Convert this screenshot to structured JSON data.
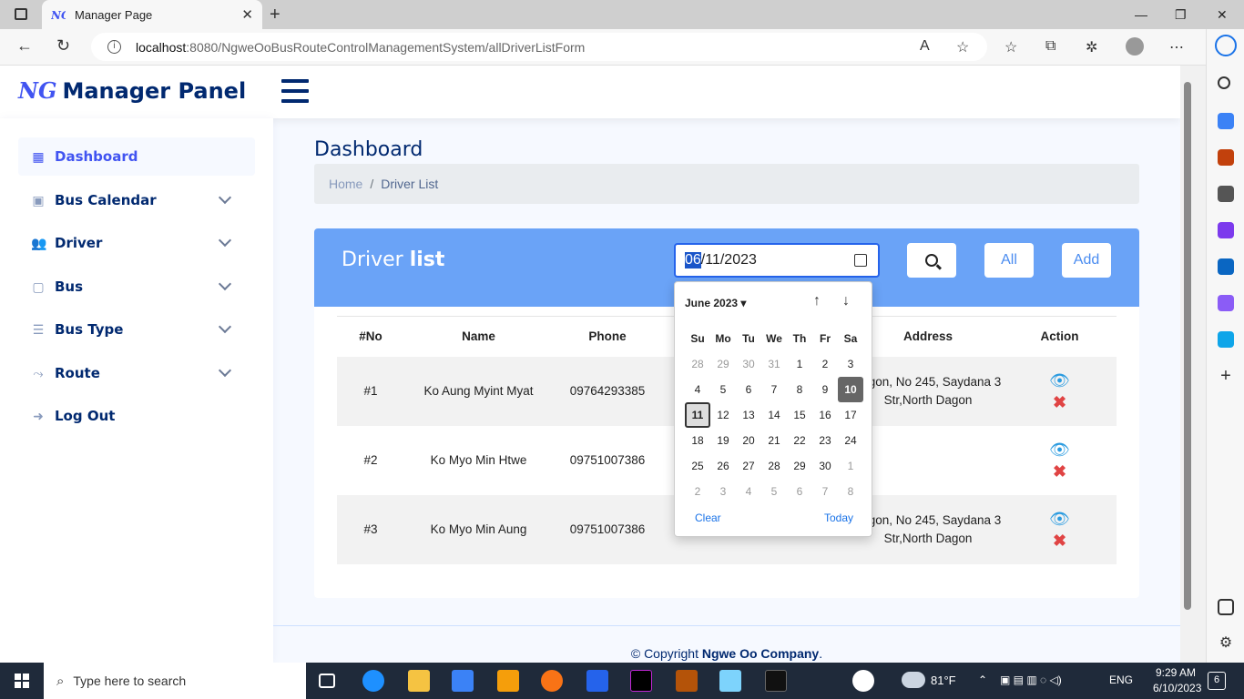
{
  "browser": {
    "tab_title": "Manager Page",
    "url_host": "localhost",
    "url_path": ":8080/NgweOoBusRouteControlManagementSystem/allDriverListForm"
  },
  "header": {
    "logo_mark": "NG",
    "logo_text": "Manager Panel"
  },
  "sidebar": {
    "items": [
      {
        "label": "Dashboard",
        "icon": "grid-icon"
      },
      {
        "label": "Bus Calendar",
        "icon": "calendar-icon"
      },
      {
        "label": "Driver",
        "icon": "people-icon"
      },
      {
        "label": "Bus",
        "icon": "bus-icon"
      },
      {
        "label": "Bus Type",
        "icon": "list-icon"
      },
      {
        "label": "Route",
        "icon": "route-icon"
      },
      {
        "label": "Log Out",
        "icon": "arrow-right-icon"
      }
    ]
  },
  "main": {
    "page_title": "Dashboard",
    "breadcrumb": {
      "home": "Home",
      "sep": "/",
      "current": "Driver List"
    }
  },
  "card": {
    "title_light": "Driver ",
    "title_bold": "list",
    "date_selected": "06",
    "date_rest": "/11/2023",
    "btn_all": "All",
    "btn_add": "Add"
  },
  "table": {
    "headers": [
      "#No",
      "Name",
      "Phone",
      "Address",
      "Action"
    ],
    "rows": [
      {
        "no": "#1",
        "name": "Ko Aung Myint Myat",
        "phone": "09764293385",
        "address": "angon, No 245, Saydana 3 Str,North Dagon"
      },
      {
        "no": "#2",
        "name": "Ko Myo Min Htwe",
        "phone": "09751007386",
        "address": ""
      },
      {
        "no": "#3",
        "name": "Ko Myo Min Aung",
        "phone": "09751007386",
        "address": "angon, No 245, Saydana 3 Str,North Dagon"
      }
    ]
  },
  "datepicker": {
    "month": "June 2023",
    "weekdays": [
      "Su",
      "Mo",
      "Tu",
      "We",
      "Th",
      "Fr",
      "Sa"
    ],
    "weeks": [
      [
        "28",
        "29",
        "30",
        "31",
        "1",
        "2",
        "3"
      ],
      [
        "4",
        "5",
        "6",
        "7",
        "8",
        "9",
        "10"
      ],
      [
        "11",
        "12",
        "13",
        "14",
        "15",
        "16",
        "17"
      ],
      [
        "18",
        "19",
        "20",
        "21",
        "22",
        "23",
        "24"
      ],
      [
        "25",
        "26",
        "27",
        "28",
        "29",
        "30",
        "1"
      ],
      [
        "2",
        "3",
        "4",
        "5",
        "6",
        "7",
        "8"
      ]
    ],
    "selected_day": "10",
    "today_day": "11",
    "clear_label": "Clear",
    "today_label": "Today"
  },
  "footer": {
    "prefix": "© Copyright ",
    "company": "Ngwe Oo Company",
    "suffix": "."
  },
  "taskbar": {
    "search_placeholder": "Type here to search",
    "weather": "81°F",
    "lang": "ENG",
    "time": "9:29 AM",
    "date": "6/10/2023",
    "notif_count": "6"
  },
  "colors": {
    "brand": "#012970",
    "accent": "#4154f1",
    "card_header": "#6aa3f7"
  }
}
